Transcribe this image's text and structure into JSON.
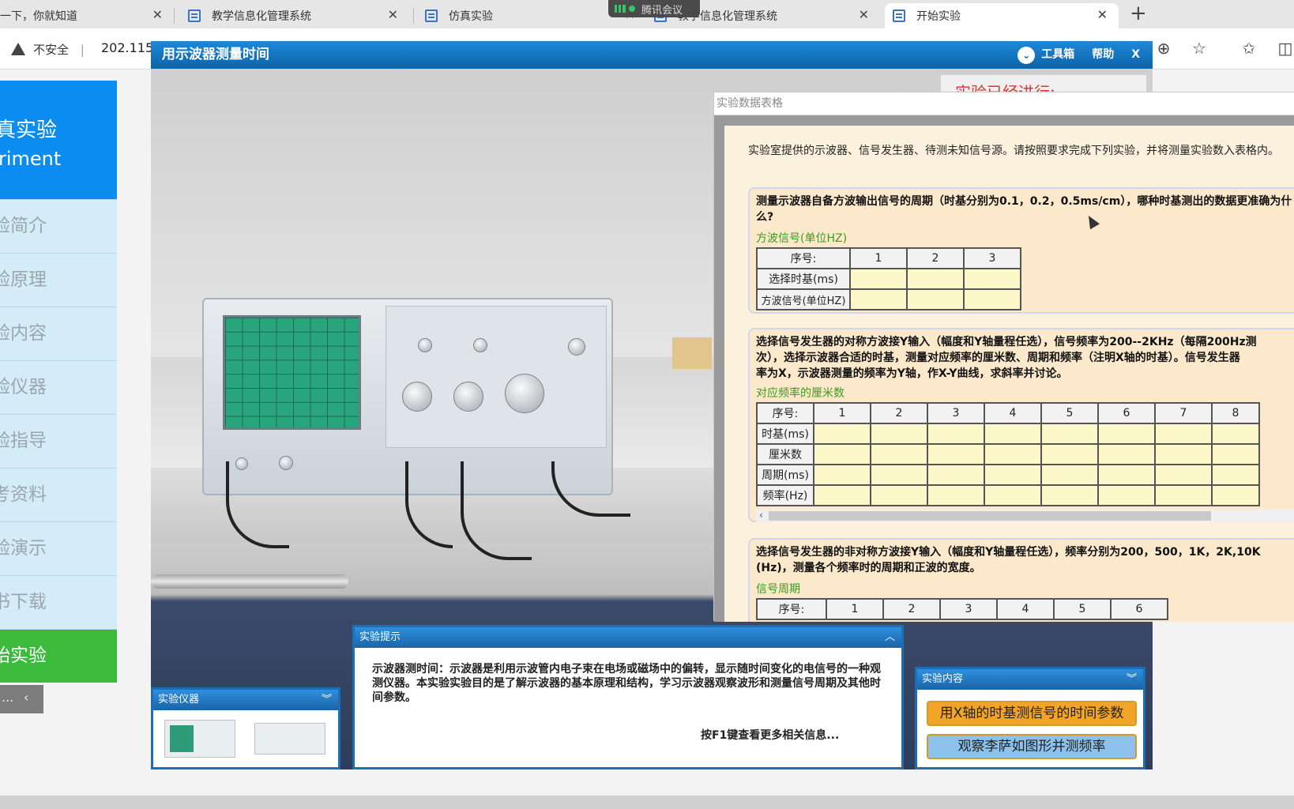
{
  "browser": {
    "tabs": [
      {
        "label": "一下，你就知道",
        "active": false
      },
      {
        "label": "教学信息化管理系统",
        "active": false
      },
      {
        "label": "仿真实验",
        "active": false
      },
      {
        "label": "教学信息化管理系统",
        "active": false
      },
      {
        "label": "开始实验",
        "active": true
      }
    ],
    "meeting_pill": "腾讯会议",
    "insecure_label": "不安全",
    "url": "202.115."
  },
  "site_sidebar": {
    "title_zh": "真实验",
    "title_en": "riment",
    "items": [
      "验简介",
      "验原理",
      "验内容",
      "验仪器",
      "验指导",
      "考资料",
      "验演示",
      "书下载",
      "始实验"
    ],
    "pager_dots": "...",
    "pager_prev": "‹"
  },
  "app": {
    "title": "用示波器测量时间",
    "toolbox": "工具箱",
    "help": "帮助",
    "close": "X",
    "progress_label": "实验已经进行:"
  },
  "data_window": {
    "title": "实验数据表格",
    "intro": "实验室提供的示波器、信号发生器、待测未知信号源。请按照要求完成下列实验，并将测量实验数入表格内。",
    "q1": {
      "text": "测量示波器自备方波输出信号的周期（时基分别为0.1，0.2，0.5ms/cm），哪种时基测出的数据更准确为什么?",
      "subtitle": "方波信号(单位HZ)",
      "header": [
        "序号:",
        "1",
        "2",
        "3"
      ],
      "rows": [
        "选择时基(ms)",
        "方波信号(单位HZ)"
      ]
    },
    "q2": {
      "text_line1": "选择信号发生器的对称方波接Y输入（幅度和Y轴量程任选），信号频率为200--2KHz（每隔200Hz测",
      "text_line2": "次），选择示波器合适的时基，测量对应频率的厘米数、周期和频率（注明X轴的时基）。信号发生器",
      "text_line3": "率为X，示波器测量的频率为Y轴，作X-Y曲线，求斜率并讨论。",
      "subtitle": "对应频率的厘米数",
      "header": [
        "序号:",
        "1",
        "2",
        "3",
        "4",
        "5",
        "6",
        "7",
        "8"
      ],
      "rows": [
        "时基(ms)",
        "厘米数",
        "周期(ms)",
        "频率(Hz)"
      ]
    },
    "q3": {
      "text_line1": "选择信号发生器的非对称方波接Y输入（幅度和Y轴量程任选），频率分别为200，500，1K，2K,10K",
      "text_line2": "(Hz)，测量各个频率时的周期和正波的宽度。",
      "subtitle": "信号周期",
      "header": [
        "序号:",
        "1",
        "2",
        "3",
        "4",
        "5",
        "6"
      ]
    }
  },
  "hint_panel": {
    "title": "实验提示",
    "body": "示波器测时间：示波器是利用示波管内电子束在电场或磁场中的偏转，显示随时间变化的电信号的一种观测仪器。本实验实验目的是了解示波器的基本原理和结构，学习示波器观察波形和测量信号周期及其他时间参数。",
    "f1": "按F1键查看更多相关信息..."
  },
  "instrument_panel": {
    "title": "实验仪器"
  },
  "content_panel": {
    "title": "实验内容",
    "btn1": "用X轴的时基测信号的时间参数",
    "btn2": "观察李萨如图形并测频率"
  },
  "colors": {
    "accent": "#0a8cf0",
    "title_bar": "#0c63a8",
    "green": "#3cba3c",
    "orange_btn": "#f2a427",
    "cell_fill": "#fdf8ca"
  }
}
